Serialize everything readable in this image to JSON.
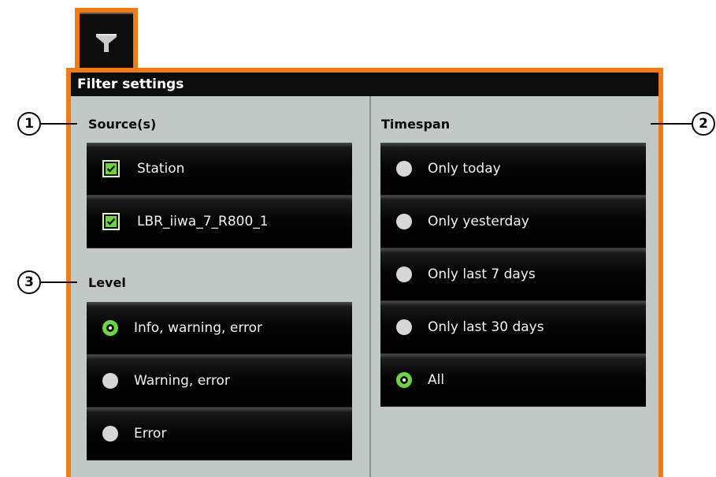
{
  "panel": {
    "title": "Filter settings",
    "tab_icon": "funnel-icon"
  },
  "sources": {
    "title": "Source(s)",
    "items": [
      {
        "label": "Station",
        "checked": true
      },
      {
        "label": "LBR_iiwa_7_R800_1",
        "checked": true
      }
    ]
  },
  "level": {
    "title": "Level",
    "items": [
      {
        "label": "Info, warning, error",
        "selected": true
      },
      {
        "label": "Warning, error",
        "selected": false
      },
      {
        "label": "Error",
        "selected": false
      }
    ]
  },
  "timespan": {
    "title": "Timespan",
    "items": [
      {
        "label": "Only today",
        "selected": false
      },
      {
        "label": "Only yesterday",
        "selected": false
      },
      {
        "label": "Only last 7 days",
        "selected": false
      },
      {
        "label": "Only last 30 days",
        "selected": false
      },
      {
        "label": "All",
        "selected": true
      }
    ]
  },
  "callouts": [
    "1",
    "2",
    "3"
  ],
  "colors": {
    "frame": "#f07c18",
    "panel_bg": "#c2c8c6",
    "selected_green": "#6cd640"
  }
}
